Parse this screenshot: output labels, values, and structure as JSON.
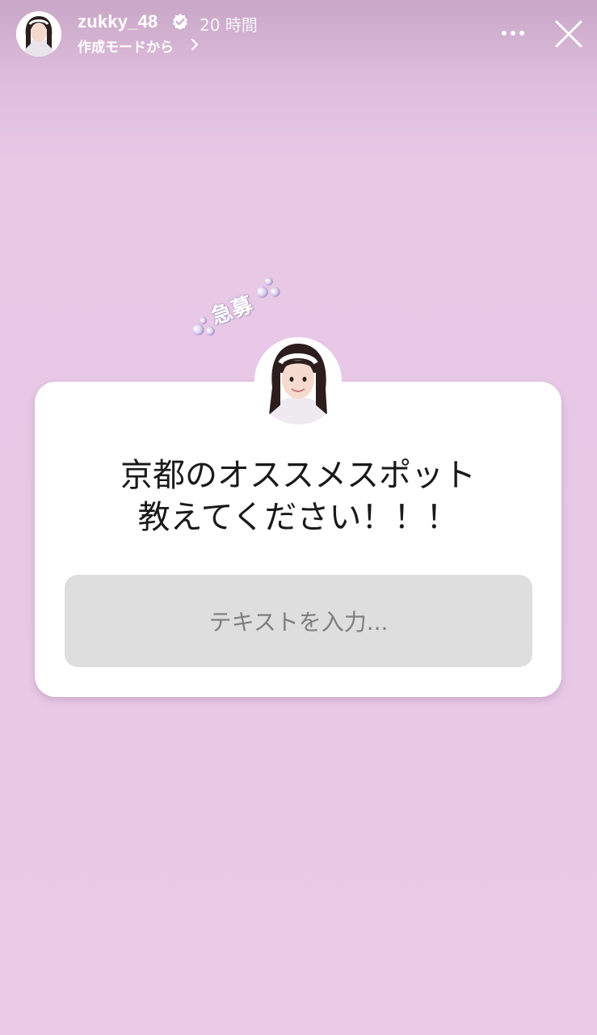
{
  "header": {
    "username": "zukky_48",
    "timestamp": "20 時間",
    "subtitle": "作成モードから"
  },
  "sticker": {
    "label": "急募"
  },
  "question_box": {
    "line1": "京都のオススメスポット",
    "line2": "教えてください！！！",
    "input_placeholder": "テキストを入力..."
  },
  "colors": {
    "background": "#e9cae7",
    "card": "#ffffff",
    "input": "#dedede",
    "verified": "#ffffff"
  },
  "icons": [
    "verified-icon",
    "chevron-right-icon",
    "more-icon",
    "close-icon",
    "bubble-icon"
  ]
}
